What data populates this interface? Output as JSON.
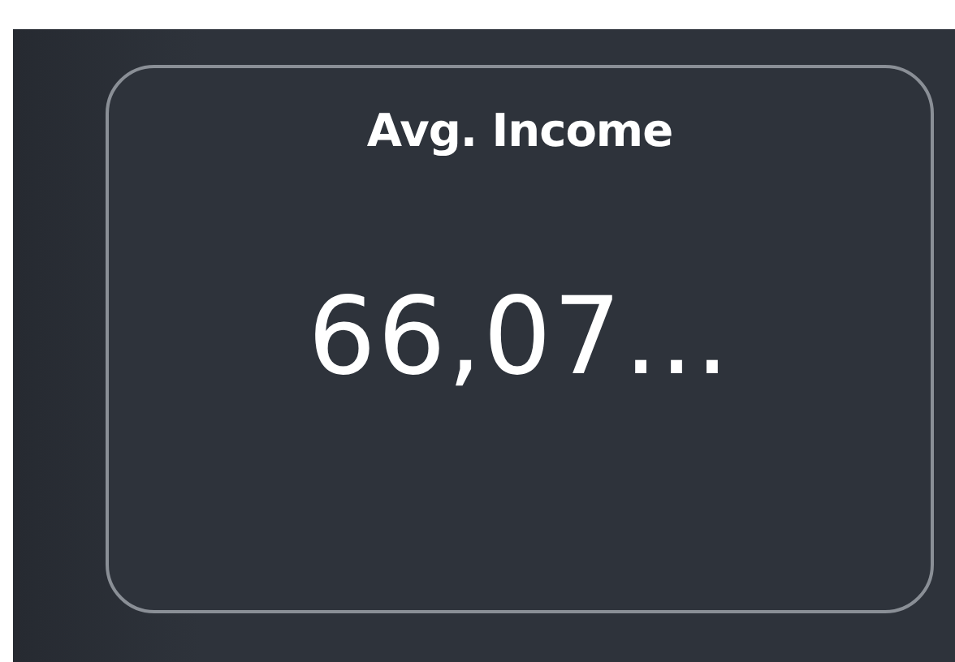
{
  "card": {
    "title": "Avg. Income",
    "value": "66,07…"
  }
}
